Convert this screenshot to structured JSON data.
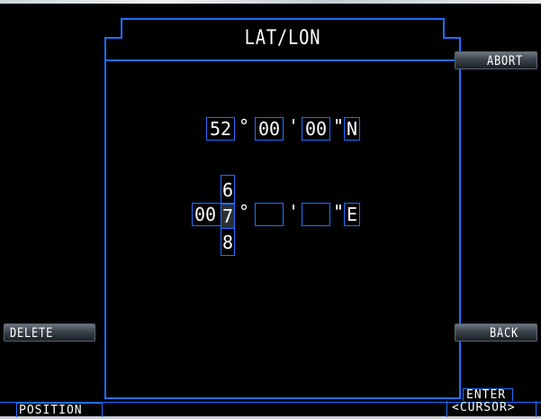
{
  "screen": {
    "title": "LAT/LON"
  },
  "softkeys": {
    "abort": "ABORT",
    "delete": "DELETE",
    "back": "BACK",
    "position": "POSITION",
    "enter_line1": "ENTER",
    "enter_line2": "<CURSOR>"
  },
  "latitude": {
    "degrees": "52",
    "deg_symbol": "°",
    "minutes": "00",
    "min_symbol": "'",
    "seconds": "00",
    "sec_symbol": "\"",
    "hemisphere": "N"
  },
  "longitude": {
    "degrees_prefix": "00",
    "degrees_active_digit": "7",
    "scroll_prev_digit": "6",
    "scroll_next_digit": "8",
    "deg_symbol": "°",
    "minutes": "",
    "min_symbol": "'",
    "seconds": "",
    "sec_symbol": "\"",
    "hemisphere": "E"
  },
  "colors": {
    "frame": "#1e6fff",
    "background": "#000000",
    "text": "#ffffff",
    "active_digit_bg": "#2b3038"
  }
}
